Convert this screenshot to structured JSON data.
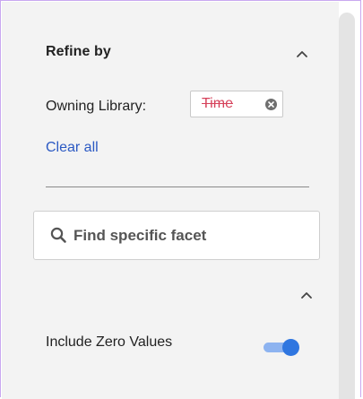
{
  "facets_panel": {
    "title": "Refine by",
    "collapse_icon": "chevron-up-icon",
    "active_filter": {
      "label": "Owning Library:",
      "value": "Time",
      "value_color": "#d6425b",
      "remove_icon": "close-circle-icon"
    },
    "clear_all_label": "Clear all",
    "clear_all_color": "#2b59c3",
    "search": {
      "placeholder": "Find specific facet",
      "value": "",
      "icon": "search-icon"
    },
    "section_collapse_icon": "chevron-up-icon",
    "include_zero": {
      "label": "Include Zero Values",
      "enabled": true,
      "accent_color": "#2f76e0"
    }
  }
}
